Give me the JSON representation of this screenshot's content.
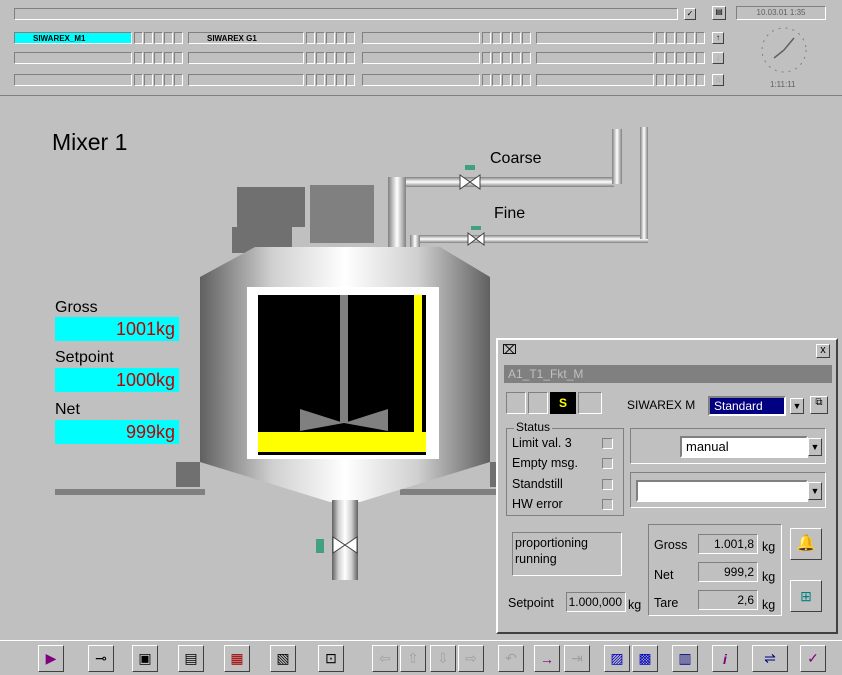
{
  "topbar": {
    "tag1": "SIWAREX_M1",
    "tag2": "SIWAREX G1",
    "date": "10.03.01 1:35",
    "time": "1:11:11"
  },
  "plant": {
    "title": "Mixer 1",
    "coarse_label": "Coarse",
    "fine_label": "Fine",
    "gross_label": "Gross",
    "gross_value": "1001kg",
    "setpoint_label": "Setpoint",
    "setpoint_value": "1000kg",
    "net_label": "Net",
    "net_value": "999kg"
  },
  "faceplate": {
    "close": "x",
    "name": "A1_T1_Fkt_M",
    "s_button": "S",
    "device_label": "SIWAREX M",
    "view_select": "Standard",
    "status_title": "Status",
    "status_items": [
      "Limit val. 3",
      "Empty msg.",
      "Standstill",
      "HW error"
    ],
    "mode_select": "manual",
    "second_select": "",
    "message": "proportioning running",
    "gross_label": "Gross",
    "gross_value": "1.001,8",
    "gross_unit": "kg",
    "net_label": "Net",
    "net_value": "999,2",
    "net_unit": "kg",
    "tare_label": "Tare",
    "tare_value": "2,6",
    "tare_unit": "kg",
    "setpoint_label": "Setpoint",
    "setpoint_value": "1.000,000",
    "setpoint_unit": "kg"
  },
  "colors": {
    "cyan": "#00ffff",
    "value_red": "#c00000",
    "yellow": "#ffff00",
    "bin_black": "#000000"
  }
}
